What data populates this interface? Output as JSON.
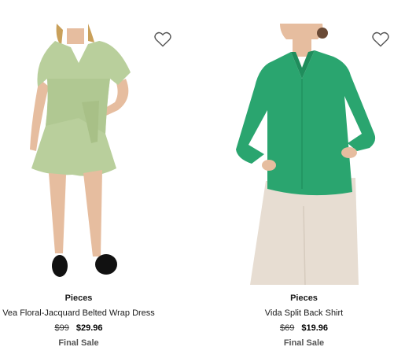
{
  "products": [
    {
      "brand": "Pieces",
      "name": "Vea Floral-Jacquard Belted Wrap Dress",
      "original_price": "$99",
      "sale_price": "$29.96",
      "badge": "Final Sale",
      "wishlist_icon": "heart-outline-icon"
    },
    {
      "brand": "Pieces",
      "name": "Vida Split Back Shirt",
      "original_price": "$69",
      "sale_price": "$19.96",
      "badge": "Final Sale",
      "wishlist_icon": "heart-outline-icon"
    }
  ],
  "colors": {
    "dress": "#b9cf9c",
    "shirt": "#2aa56f",
    "pants": "#e7ddd2",
    "skin": "#e9c3a6",
    "text": "#1a1a1a"
  }
}
